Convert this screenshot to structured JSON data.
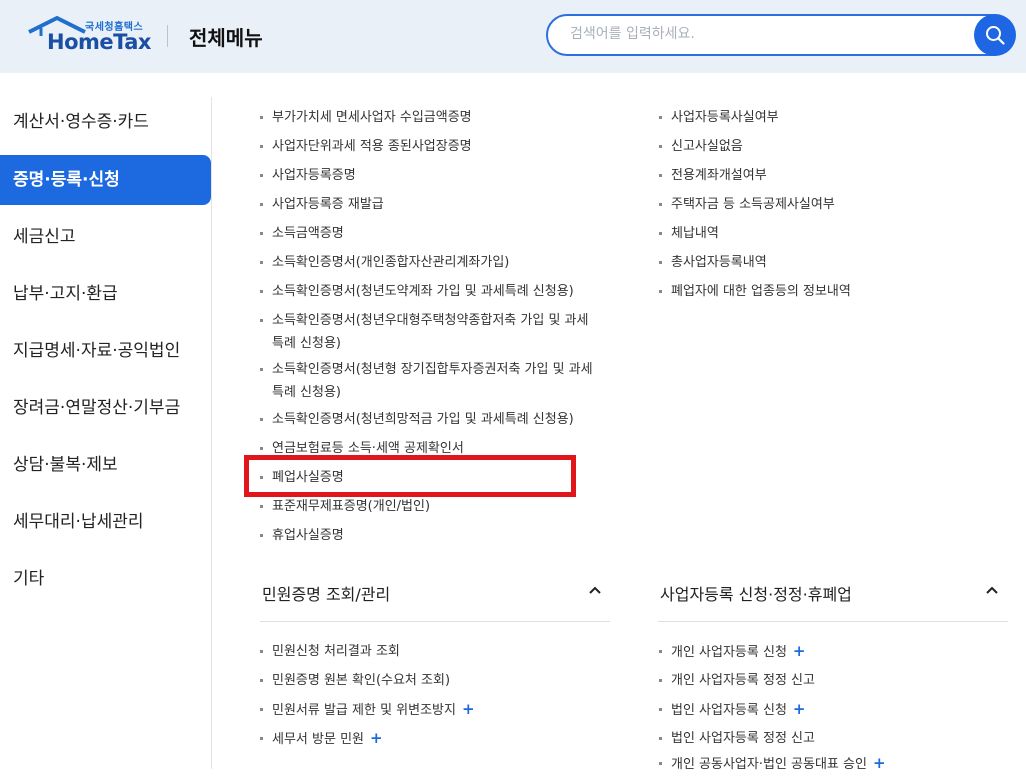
{
  "header": {
    "logo_sub": "국세청홈택스",
    "logo_main": "HomeTax",
    "title": "전체메뉴",
    "search_placeholder": "검색어를 입력하세요."
  },
  "sidebar": {
    "items": [
      {
        "label": "계산서·영수증·카드",
        "active": false
      },
      {
        "label": "증명·등록·신청",
        "active": true
      },
      {
        "label": "세금신고",
        "active": false
      },
      {
        "label": "납부·고지·환급",
        "active": false
      },
      {
        "label": "지급명세·자료·공익법인",
        "active": false
      },
      {
        "label": "장려금·연말정산·기부금",
        "active": false
      },
      {
        "label": "상담·불복·제보",
        "active": false
      },
      {
        "label": "세무대리·납세관리",
        "active": false
      },
      {
        "label": "기타",
        "active": false
      }
    ]
  },
  "certs_left": [
    "부가가치세 면세사업자 수입금액증명",
    "사업자단위과세 적용 종된사업장증명",
    "사업자등록증명",
    "사업자등록증 재발급",
    "소득금액증명",
    "소득확인증명서(개인종합자산관리계좌가입)",
    "소득확인증명서(청년도약계좌 가입 및 과세특례 신청용)",
    "소득확인증명서(청년우대형주택청약종합저축 가입 및 과세특례 신청용)",
    "소득확인증명서(청년형 장기집합투자증권저축 가입 및 과세특례 신청용)",
    "소득확인증명서(청년희망적금 가입 및 과세특례 신청용)",
    "연금보험료등 소득·세액 공제확인서",
    "폐업사실증명",
    "표준재무제표증명(개인/법인)",
    "휴업사실증명"
  ],
  "certs_right": [
    "사업자등록사실여부",
    "신고사실없음",
    "전용계좌개설여부",
    "주택자금 등 소득공제사실여부",
    "체납내역",
    "총사업자등록내역",
    "폐업자에 대한 업종등의 정보내역"
  ],
  "section_civil": {
    "title": "민원증명 조회/관리",
    "items": [
      {
        "label": "민원신청 처리결과 조회",
        "plus": ""
      },
      {
        "label": "민원증명 원본 확인(수요처 조회)",
        "plus": ""
      },
      {
        "label": "민원서류 발급 제한 및 위변조방지",
        "plus": "+"
      },
      {
        "label": "세무서 방문 민원",
        "plus": "+"
      }
    ]
  },
  "section_biz": {
    "title": "사업자등록 신청·정정·휴폐업",
    "items": [
      {
        "label": "개인 사업자등록 신청",
        "plus": "+"
      },
      {
        "label": "개인 사업자등록 정정 신고",
        "plus": ""
      },
      {
        "label": "법인 사업자등록 신청",
        "plus": "+"
      },
      {
        "label": "법인 사업자등록 정정 신고",
        "plus": ""
      },
      {
        "label": "개인 공동사업자·법인 공동대표 승인",
        "plus": "+"
      }
    ]
  },
  "colors": {
    "accent": "#1d6ae0",
    "highlight": "#e0161b",
    "header_bg": "#eaf0f8"
  }
}
